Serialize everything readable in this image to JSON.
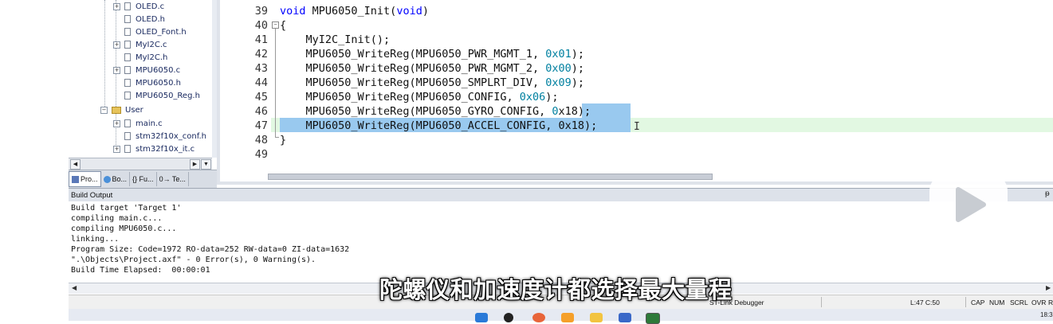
{
  "project_tree": {
    "items": [
      {
        "label": "OLED.c",
        "expandable": true
      },
      {
        "label": "OLED.h",
        "expandable": false
      },
      {
        "label": "OLED_Font.h",
        "expandable": false
      },
      {
        "label": "MyI2C.c",
        "expandable": true
      },
      {
        "label": "MyI2C.h",
        "expandable": false
      },
      {
        "label": "MPU6050.c",
        "expandable": true
      },
      {
        "label": "MPU6050.h",
        "expandable": false
      },
      {
        "label": "MPU6050_Reg.h",
        "expandable": false
      },
      {
        "label": "User",
        "expandable": true,
        "folder": true
      },
      {
        "label": "main.c",
        "expandable": true
      },
      {
        "label": "stm32f10x_conf.h",
        "expandable": false
      },
      {
        "label": "stm32f10x_it.c",
        "expandable": true
      }
    ]
  },
  "panel_tabs": [
    {
      "label": "Pro...",
      "active": true
    },
    {
      "label": "Bo...",
      "active": false
    },
    {
      "label": "{} Fu...",
      "active": false
    },
    {
      "label": "0→ Te...",
      "active": false
    }
  ],
  "editor": {
    "line_numbers": [
      "39",
      "40",
      "41",
      "42",
      "43",
      "44",
      "45",
      "46",
      "47",
      "48",
      "49"
    ],
    "lines": {
      "l39_kw1": "void",
      "l39_mid": " MPU6050_Init(",
      "l39_kw2": "void",
      "l39_end": ")",
      "l40": "{",
      "l41": "    MyI2C_Init();",
      "l42_a": "    MPU6050_WriteReg(MPU6050_PWR_MGMT_1, ",
      "l42_hex": "0x01",
      "l42_b": ");",
      "l43_a": "    MPU6050_WriteReg(MPU6050_PWR_MGMT_2, ",
      "l43_hex": "0x00",
      "l43_b": ");",
      "l44_a": "    MPU6050_WriteReg(MPU6050_SMPLRT_DIV, ",
      "l44_hex": "0x09",
      "l44_b": ");",
      "l45_a": "    MPU6050_WriteReg(MPU6050_CONFIG, ",
      "l45_hex": "0x06",
      "l45_b": ");",
      "l46_a": "    MPU6050_WriteReg(MPU6050_GYRO_CONFIG, ",
      "l46_hex1": "0",
      "l46_sel": "x18);",
      "l47": "    MPU6050_WriteReg(MPU6050_ACCEL_CONFIG, 0x18);",
      "l48": "}",
      "l49": ""
    }
  },
  "build_output": {
    "title": "Build Output",
    "lines": [
      "Build target 'Target 1'",
      "compiling main.c...",
      "compiling MPU6050.c...",
      "linking...",
      "Program Size: Code=1972 RO-data=252 RW-data=0 ZI-data=1632",
      "\".\\Objects\\Project.axf\" - 0 Error(s), 0 Warning(s).",
      "Build Time Elapsed:  00:00:01"
    ]
  },
  "status_bar": {
    "debugger": "ST-Link Debugger",
    "position": "L:47 C:50",
    "indicators": [
      "CAP",
      "NUM",
      "SCRL",
      "OVR",
      "R"
    ]
  },
  "taskbar": {
    "clock": "18:3"
  },
  "subtitle": "陀螺仪和加速度计都选择最大量程",
  "colors": {
    "selection": "#99c9ef",
    "current_line": "#e2f8e2",
    "keyword": "#0000ff",
    "hex_literal": "#0080a0"
  }
}
